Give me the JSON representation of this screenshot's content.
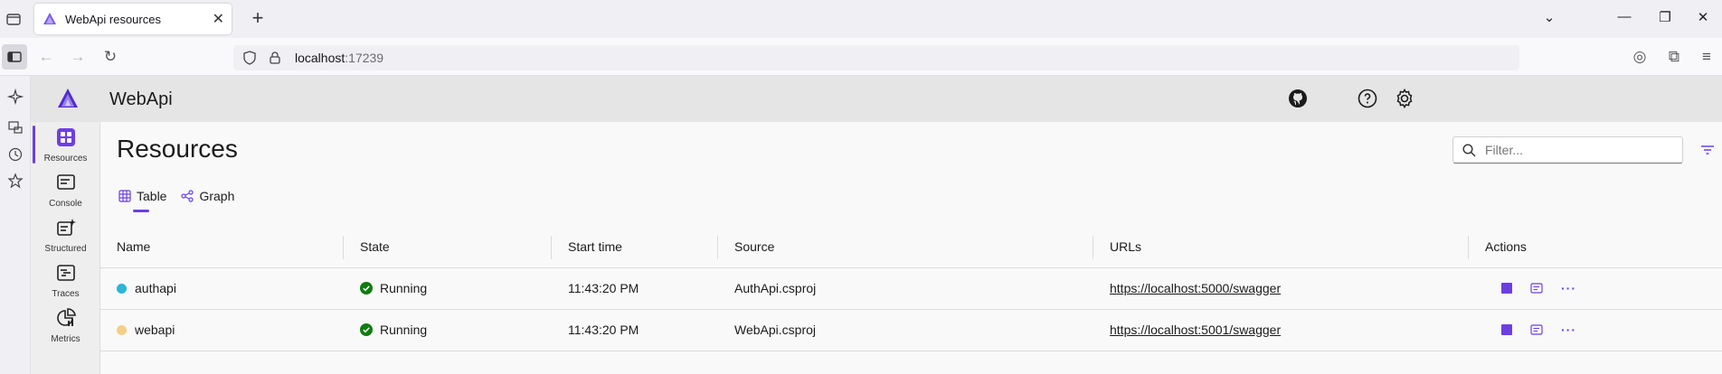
{
  "browser": {
    "tab_title": "WebApi resources",
    "new_tab": "+",
    "url_host": "localhost",
    "url_port": ":17239"
  },
  "app": {
    "title": "WebApi",
    "page_title": "Resources",
    "filter_placeholder": "Filter...",
    "nav": [
      {
        "label": "Resources",
        "icon": "resources-icon"
      },
      {
        "label": "Console",
        "icon": "console-icon"
      },
      {
        "label": "Structured",
        "icon": "structured-icon"
      },
      {
        "label": "Traces",
        "icon": "traces-icon"
      },
      {
        "label": "Metrics",
        "icon": "metrics-icon"
      }
    ],
    "view_tabs": {
      "table": "Table",
      "graph": "Graph"
    },
    "columns": [
      "Name",
      "State",
      "Start time",
      "Source",
      "URLs",
      "Actions"
    ],
    "rows": [
      {
        "name": "authapi",
        "state": "Running",
        "start_time": "11:43:20 PM",
        "source": "AuthApi.csproj",
        "url": "https://localhost:5000/swagger",
        "dot_color": "#2bb5d6"
      },
      {
        "name": "webapi",
        "state": "Running",
        "start_time": "11:43:20 PM",
        "source": "WebApi.csproj",
        "url": "https://localhost:5001/swagger",
        "dot_color": "#f5cf86"
      }
    ],
    "colors": {
      "accent": "#6c3fe3",
      "running": "#107c10"
    }
  }
}
